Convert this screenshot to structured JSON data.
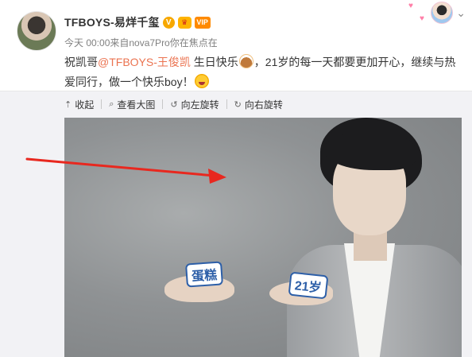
{
  "post": {
    "author": "TFBOYS-易烊千玺",
    "badges": {
      "verified": "V",
      "crown": "♛",
      "vip": "VIP"
    },
    "meta": "今天 00:00来自nova7Pro你在焦点在",
    "text_before": "祝凯哥",
    "mention": "@TFBOYS-王俊凯",
    "text_mid": " 生日快乐",
    "text_after": "，21岁的每一天都要更加开心，继续与热爱同行，做一个快乐boy！",
    "emojis": [
      "cake-emoji",
      "laugh-emoji"
    ]
  },
  "toolbar": {
    "collapse": "收起",
    "view_large": "查看大图",
    "rotate_left": "向左旋转",
    "rotate_right": "向右旋转"
  },
  "image": {
    "sticker_left": "蛋糕",
    "sticker_right": "21岁"
  },
  "colors": {
    "mention": "#eb7350",
    "panel": "#f2f2f5",
    "arrow": "#e8281f",
    "sticker": "#2d5fa8"
  }
}
